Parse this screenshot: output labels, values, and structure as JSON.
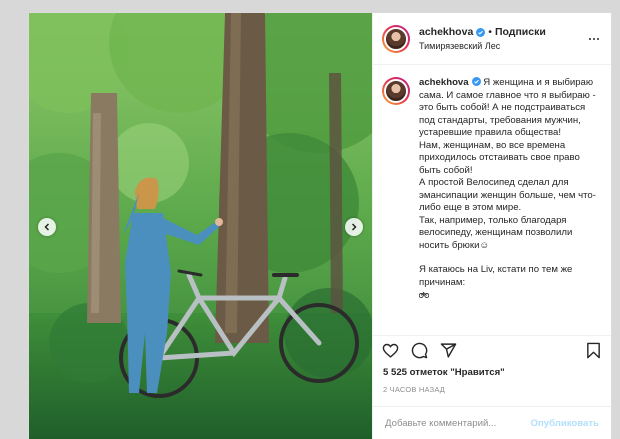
{
  "post": {
    "author": {
      "username": "achekhova",
      "verified": true,
      "follow_label": "Подписки",
      "location": "Тимирязевский Лес",
      "avatar_icon": "avatar-icon"
    },
    "caption": {
      "username": "achekhova",
      "paragraphs": [
        "Я женщина и я выбираю сама. И самое главное что я выбираю - это быть собой! А не подстраиваться под стандарты, требования мужчин, устаревшие правила общества!",
        "Нам, женщинам, во все времена приходилось отстаивать свое право быть собой!",
        "А простой Велосипед сделал для эмансипации женщин больше, чем что-либо еще в этом мире.",
        "Так, например, только благодаря велосипеду, женщинам позволили носить брюки☺",
        "",
        "Я катаюсь на Liv, кстати по тем же причинам:"
      ]
    },
    "likes_text": "5 525 отметок \"Нравится\"",
    "time_text": "2 ЧАСОВ НАЗАД",
    "comment": {
      "placeholder": "Добавьте комментарий...",
      "publish_label": "Опубликовать"
    },
    "colors": {
      "accent": "#0095f6",
      "publish_disabled": "#b2dffc",
      "verified": "#3897f0"
    },
    "icons": [
      "heart-icon",
      "comment-icon",
      "share-icon",
      "bookmark-icon",
      "more-icon",
      "chevron-left-icon",
      "chevron-right-icon",
      "verified-icon",
      "bicycle-emoji-icon"
    ]
  }
}
